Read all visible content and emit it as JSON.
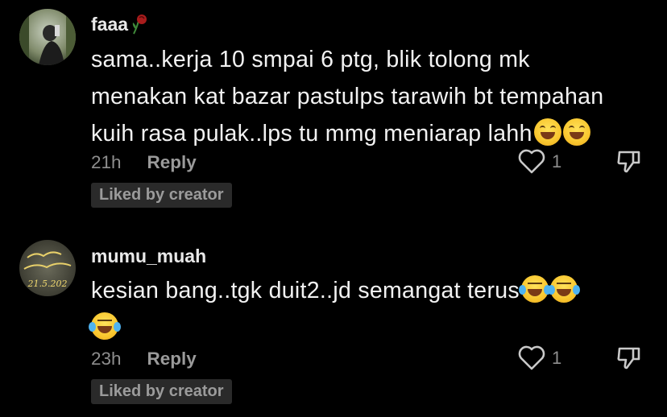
{
  "comments": [
    {
      "username": "faaa",
      "text_lines": [
        "sama..kerja 10 smpai 6 ptg, blik tolong mk",
        "menakan kat bazar pastulps tarawih bt tempahan",
        "kuih rasa pulak..lps tu mmg meniarap lahh"
      ],
      "emojis": [
        "grinning-squinting-face",
        "grinning-squinting-face"
      ],
      "time": "21h",
      "reply_label": "Reply",
      "like_count": "1",
      "badge": "Liked by creator"
    },
    {
      "username": "mumu_muah",
      "text_lines": [
        "kesian bang..tgk duit2..jd semangat terus"
      ],
      "emojis": [
        "face-with-tears-of-joy",
        "face-with-tears-of-joy",
        "face-with-tears-of-joy"
      ],
      "avatar_text": "21.5.202",
      "time": "23h",
      "reply_label": "Reply",
      "like_count": "1",
      "badge": "Liked by creator"
    }
  ]
}
